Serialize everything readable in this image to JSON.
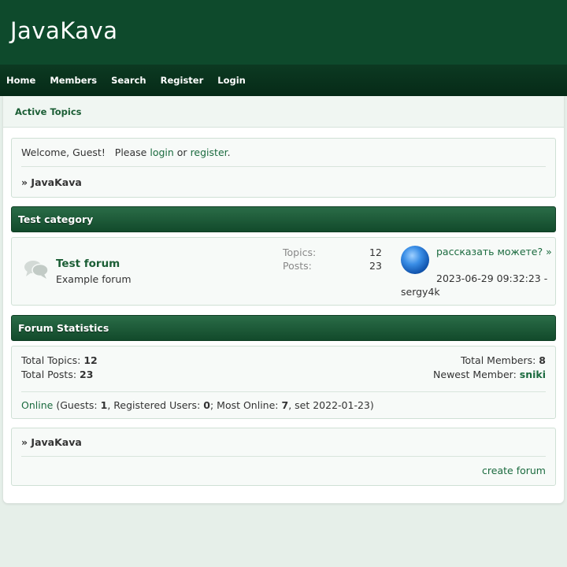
{
  "site": {
    "title": "JavaKava"
  },
  "nav": {
    "items": [
      "Home",
      "Members",
      "Search",
      "Register",
      "Login"
    ]
  },
  "subnav": {
    "active_topics": "Active Topics"
  },
  "welcome": {
    "prefix": "Welcome, Guest!",
    "please": "Please",
    "login": "login",
    "or": "or",
    "register": "register",
    "period": ".",
    "breadcrumb": "» JavaKava"
  },
  "category": {
    "title": "Test category",
    "forum": {
      "icon": "speech-bubbles-icon",
      "title": "Test forum",
      "description": "Example forum",
      "topics_label": "Topics:",
      "topics": "12",
      "posts_label": "Posts:",
      "posts": "23",
      "last_post": {
        "title": "рассказать можете? »",
        "date": "2023-06-29 09:32:23 -",
        "user": "sergy4k"
      }
    }
  },
  "stats": {
    "title": "Forum Statistics",
    "total_topics_label": "Total Topics:",
    "total_topics": "12",
    "total_posts_label": "Total Posts:",
    "total_posts": "23",
    "total_members_label": "Total Members:",
    "total_members": "8",
    "newest_member_label": "Newest Member:",
    "newest_member": "sniki",
    "online_link": "Online",
    "guests_label": "(Guests:",
    "guests": "1",
    "registered_label": ", Registered Users:",
    "registered": "0",
    "most_online_label": "; Most Online:",
    "most_online": "7",
    "most_online_date": ", set 2022-01-23)"
  },
  "footer": {
    "breadcrumb": "» JavaKava",
    "create_forum": "create forum"
  },
  "colors": {
    "header": "#0e4a2c",
    "navbar": "#062a17",
    "link": "#1b6b3f",
    "background": "#e6efe9"
  }
}
